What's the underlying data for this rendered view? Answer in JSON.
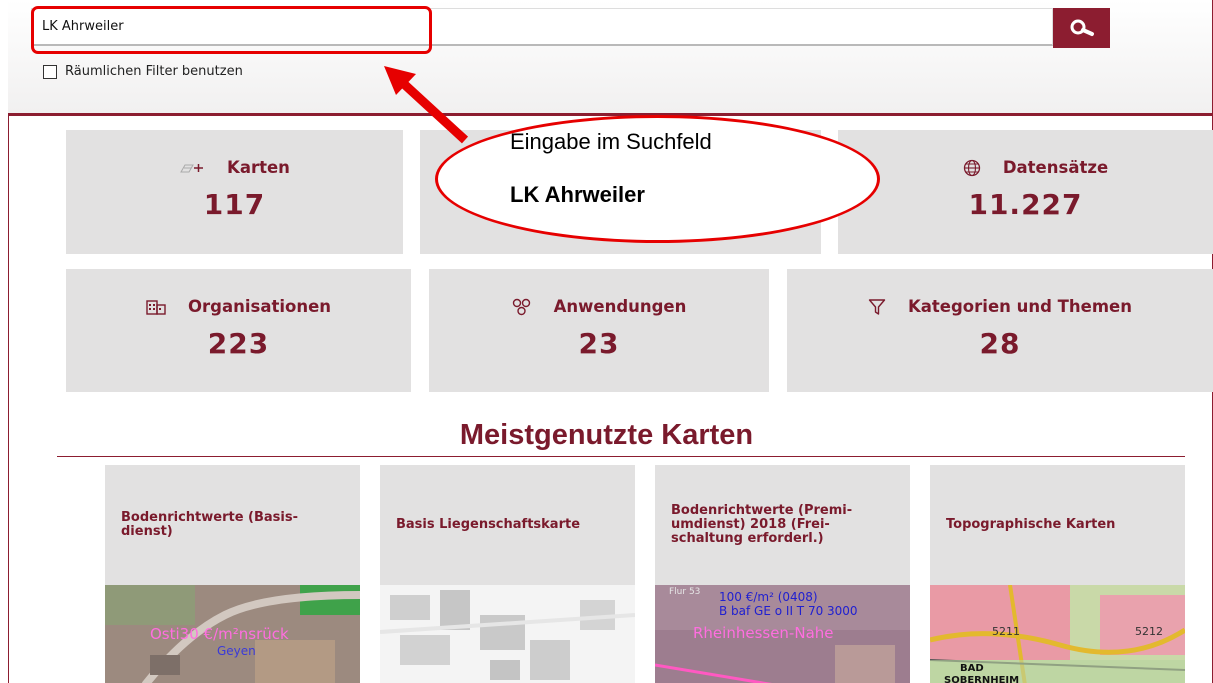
{
  "search": {
    "value": "LK Ahrweiler",
    "spatial_filter_label": "Räumlichen Filter benutzen"
  },
  "stats": [
    {
      "label": "Karten",
      "value": "117",
      "icon": "map-add-icon"
    },
    {
      "label": "Datensätze",
      "value": "11.227",
      "icon": "globe-icon"
    },
    {
      "label": "Organisationen",
      "value": "223",
      "icon": "building-icon"
    },
    {
      "label": "Anwendungen",
      "value": "23",
      "icon": "apps-icon"
    },
    {
      "label": "Kategorien und Themen",
      "value": "28",
      "icon": "filter-icon"
    }
  ],
  "callout": {
    "line1": "Eingabe im Suchfeld",
    "line2": "LK Ahrweiler"
  },
  "section": {
    "title": "Meistgenutzte Karten"
  },
  "cards": [
    {
      "title": "Bodenrichtwerte (Basis-dienst)",
      "map_text": [
        "Osti30 €/m²nsrück",
        "Geyen"
      ]
    },
    {
      "title": "Basis Liegenschaftskarte",
      "map_text": []
    },
    {
      "title": "Bodenrichtwerte (Premi-umdienst) 2018 (Frei-schaltung erforderl.)",
      "map_text": [
        "Flur 53",
        "100 €/m² (0408)",
        "B baf GE o II T 70 3000",
        "Rheinhessen-Nahe"
      ]
    },
    {
      "title": "Topographische Karten",
      "map_text": [
        "5211",
        "5212",
        "BAD",
        "SOBERNHEIM"
      ]
    }
  ],
  "colors": {
    "accent": "#8c1d30",
    "tile": "#e2e1e1",
    "highlight": "#e60000"
  }
}
